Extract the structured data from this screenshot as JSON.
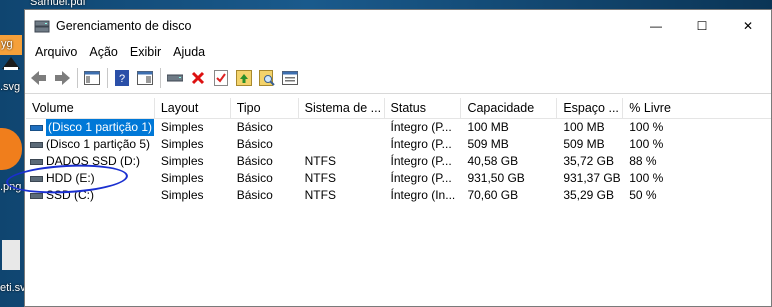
{
  "desktop": {
    "labels": [
      "Samuel.pdf",
      "yg",
      ".svg",
      ".png",
      "eti.svg"
    ]
  },
  "window": {
    "title": "Gerenciamento de disco",
    "controls": {
      "minimize": "—",
      "maximize": "☐",
      "close": "✕"
    }
  },
  "menu": [
    "Arquivo",
    "Ação",
    "Exibir",
    "Ajuda"
  ],
  "toolbar_icons": [
    "back-icon",
    "forward-icon",
    "console-tree-icon",
    "help-icon",
    "properties-icon",
    "connect-icon",
    "delete-icon",
    "check-icon",
    "import-icon",
    "search-icon",
    "settings-icon"
  ],
  "columns": [
    "Volume",
    "Layout",
    "Tipo",
    "Sistema de ...",
    "Status",
    "Capacidade",
    "Espaço ...",
    "% Livre"
  ],
  "rows": [
    {
      "volume": "(Disco 1 partição 1)",
      "layout": "Simples",
      "tipo": "Básico",
      "fs": "",
      "status": "Íntegro (P...",
      "capacidade": "100 MB",
      "espaco": "100 MB",
      "livre": "100 %",
      "selected": true
    },
    {
      "volume": "(Disco 1 partição 5)",
      "layout": "Simples",
      "tipo": "Básico",
      "fs": "",
      "status": "Íntegro (P...",
      "capacidade": "509 MB",
      "espaco": "509 MB",
      "livre": "100 %"
    },
    {
      "volume": "DADOS SSD (D:)",
      "layout": "Simples",
      "tipo": "Básico",
      "fs": "NTFS",
      "status": "Íntegro (P...",
      "capacidade": "40,58 GB",
      "espaco": "35,72 GB",
      "livre": "88 %"
    },
    {
      "volume": "HDD (E:)",
      "layout": "Simples",
      "tipo": "Básico",
      "fs": "NTFS",
      "status": "Íntegro (P...",
      "capacidade": "931,50 GB",
      "espaco": "931,37 GB",
      "livre": "100 %"
    },
    {
      "volume": "SSD (C:)",
      "layout": "Simples",
      "tipo": "Básico",
      "fs": "NTFS",
      "status": "Íntegro (In...",
      "capacidade": "70,60 GB",
      "espaco": "35,29 GB",
      "livre": "50 %"
    }
  ]
}
